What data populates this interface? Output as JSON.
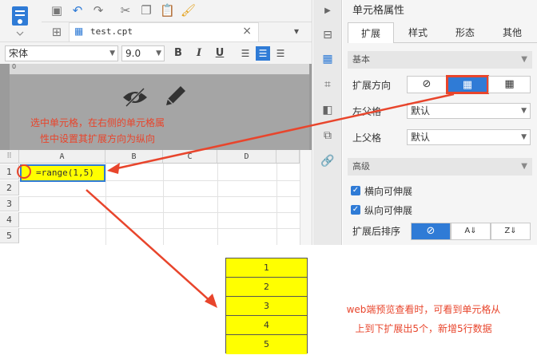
{
  "toolbar": {
    "file_tab": "test.cpt",
    "font_name": "宋体",
    "font_size": "9.0",
    "bold": "B",
    "italic": "I",
    "underline": "U"
  },
  "grid": {
    "columns": [
      "A",
      "B",
      "C",
      "D"
    ],
    "rows": [
      "1",
      "2",
      "3",
      "4",
      "5"
    ],
    "cell_a1": "=range(1,5)"
  },
  "panel": {
    "title": "单元格属性",
    "tabs": [
      "扩展",
      "样式",
      "形态",
      "其他"
    ],
    "section_basic": "基本",
    "expand_dir_label": "扩展方向",
    "parent_left_label": "左父格",
    "parent_left_value": "默认",
    "parent_top_label": "上父格",
    "parent_top_value": "默认",
    "section_advanced": "高级",
    "hor_extend": "横向可伸展",
    "ver_extend": "纵向可伸展",
    "sort_label": "扩展后排序"
  },
  "annotations": {
    "note1_line1": "选中单元格，在右侧的单元格属",
    "note1_line2": "性中设置其扩展方向为纵向",
    "note2_line1": "web端预览查看时，可看到单元格从",
    "note2_line2": "上到下扩展出5个，新增5行数据"
  },
  "output": {
    "values": [
      "1",
      "2",
      "3",
      "4",
      "5"
    ]
  },
  "colors": {
    "accent": "#2f7bd6",
    "highlight": "#e8452c",
    "cell_fill": "#ffff00"
  }
}
